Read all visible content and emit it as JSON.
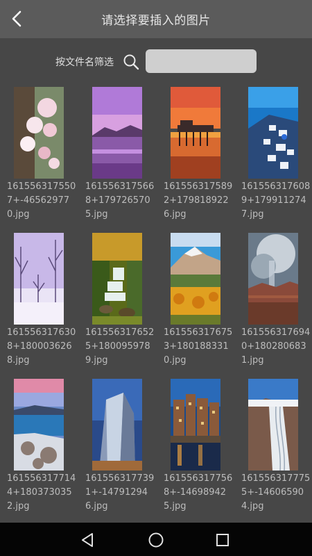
{
  "header": {
    "title": "请选择要插入的图片",
    "back_icon": "chevron-left-icon"
  },
  "filter": {
    "label": "按文件名筛选",
    "search_icon": "search-icon",
    "value": "",
    "placeholder": ""
  },
  "images": [
    {
      "name": "1615563175507+-465629770.jpg",
      "theme": "cherry-blossom"
    },
    {
      "name": "1615563175668+1797265705.jpg",
      "theme": "purple-lake"
    },
    {
      "name": "1615563175892+1798189226.jpg",
      "theme": "pier-sunset"
    },
    {
      "name": "1615563176089+1799112747.jpg",
      "theme": "santorini"
    },
    {
      "name": "1615563176308+1800036268.jpg",
      "theme": "winter-trees"
    },
    {
      "name": "1615563176525+1800959789.jpg",
      "theme": "forest-waterfall"
    },
    {
      "name": "1615563176753+1801883310.jpg",
      "theme": "autumn-mountain"
    },
    {
      "name": "1615563176940+1802806831.jpg",
      "theme": "canyon-storm"
    },
    {
      "name": "1615563177144+1803730352.jpg",
      "theme": "frozen-lake"
    },
    {
      "name": "1615563177391+-147912946.jpg",
      "theme": "metal-building"
    },
    {
      "name": "1615563177568+-146989425.jpg",
      "theme": "canal-city"
    },
    {
      "name": "1615563177755+-146065904.jpg",
      "theme": "glacier"
    }
  ],
  "navbar": {
    "back_icon": "triangle-back-icon",
    "home_icon": "circle-home-icon",
    "recents_icon": "square-recents-icon"
  }
}
